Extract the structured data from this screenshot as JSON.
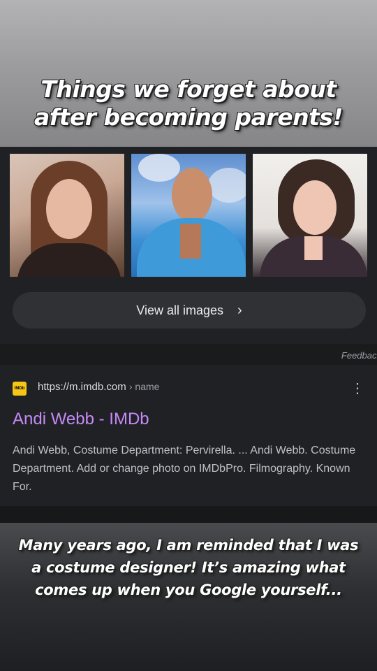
{
  "story": {
    "headline_line1": "Things we forget about",
    "headline_line2": "after becoming parents!",
    "caption_line1": "Many years ago, I am reminded that I was",
    "caption_line2": "a costume designer! It’s amazing what",
    "caption_line3": "comes up when you Google yourself..."
  },
  "images": {
    "view_all_label": "View all images",
    "chevron_icon": "chevron-right-icon"
  },
  "feedback_label": "Feedback",
  "result": {
    "favicon_text": "IMDb",
    "url": "https://m.imdb.com",
    "url_path": "› name",
    "title": "Andi Webb - IMDb",
    "snippet": "Andi Webb, Costume Department: Pervirella. ... Andi Webb. Costume Department. Add or change photo on IMDbPro. Filmography. Known For.",
    "menu_icon": "more-vert-icon"
  },
  "colors": {
    "background": "#202124",
    "link_visited": "#c58af9",
    "imdb_yellow": "#f5c518"
  }
}
